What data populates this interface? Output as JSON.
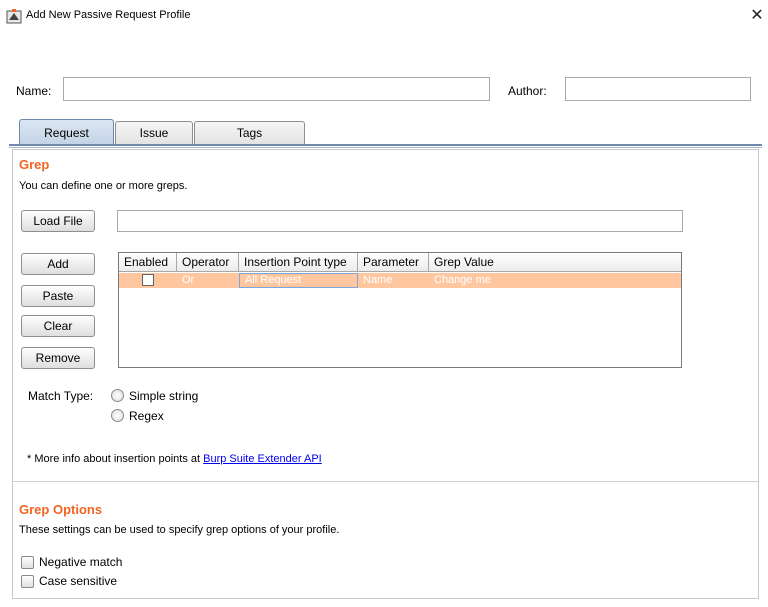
{
  "window": {
    "title": "Add New Passive Request Profile",
    "close_icon": "close-icon",
    "app_icon": "burp-app-icon"
  },
  "header": {
    "name_label": "Name:",
    "name_value": "",
    "author_label": "Author:",
    "author_value": ""
  },
  "tabs": [
    {
      "label": "Request",
      "active": true
    },
    {
      "label": "Issue",
      "active": false
    },
    {
      "label": "Tags",
      "active": false
    }
  ],
  "grep": {
    "title": "Grep",
    "description": "You can define one or more greps.",
    "load_file_label": "Load File",
    "load_file_path": "",
    "buttons": {
      "add": "Add",
      "paste": "Paste",
      "clear": "Clear",
      "remove": "Remove"
    },
    "table": {
      "columns": [
        "Enabled",
        "Operator",
        "Insertion Point type",
        "Parameter",
        "Grep Value"
      ],
      "rows": [
        {
          "enabled": true,
          "operator": "Or",
          "insertion_point": "All Request",
          "parameter": "Name",
          "grep_value": "Change me"
        }
      ],
      "selected_row_color": "#ffc7a0"
    },
    "match_type": {
      "label": "Match Type:",
      "options": [
        "Simple string",
        "Regex"
      ],
      "selected": null
    },
    "info_prefix": "* More info about insertion points at",
    "info_link": "Burp Suite Extender API"
  },
  "grep_options": {
    "title": "Grep Options",
    "description": "These settings can be used to specify grep options of your profile.",
    "negative_match": {
      "label": "Negative match",
      "checked": false
    },
    "case_sensitive": {
      "label": "Case sensitive",
      "checked": false
    }
  },
  "colors": {
    "accent": "#f26522",
    "link": "#0000ee",
    "tab_active": "#c3d3e6"
  }
}
